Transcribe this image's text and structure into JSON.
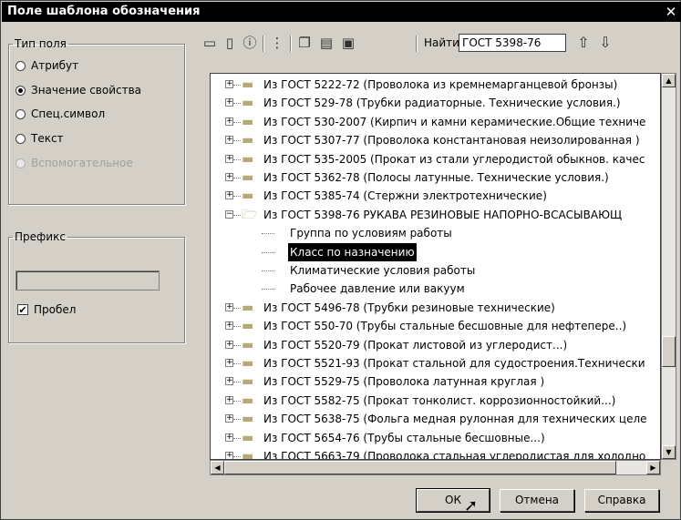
{
  "window": {
    "title": "Поле шаблона обозначения",
    "close_glyph": "✕"
  },
  "field_type": {
    "legend": "Тип поля",
    "options": [
      {
        "label": "Атрибут",
        "checked": false,
        "disabled": false
      },
      {
        "label": "Значение свойства",
        "checked": true,
        "disabled": false
      },
      {
        "label": "Спец.символ",
        "checked": false,
        "disabled": false
      },
      {
        "label": "Текст",
        "checked": false,
        "disabled": false
      },
      {
        "label": "Вспомогательное",
        "checked": false,
        "disabled": true
      }
    ]
  },
  "prefix": {
    "legend": "Префикс",
    "value": "",
    "space_checkbox": {
      "label": "Пробел",
      "checked": true,
      "mark": "✔"
    }
  },
  "toolbar": {
    "icons": [
      "folder-icon",
      "new-document-icon",
      "info-icon",
      "properties-icon",
      "copy-icon",
      "paste-icon",
      "clipboard-icon"
    ],
    "find_label": "Найти",
    "find_value": "ГОСТ 5398-76",
    "up_glyph": "⇧",
    "down_glyph": "⇩"
  },
  "tree": {
    "items": [
      {
        "level": 0,
        "text": "Из ГОСТ 5222-72 (Проволока из кремнемарганцевой бронзы)",
        "expander": "+"
      },
      {
        "level": 0,
        "text": "Из ГОСТ 529-78 (Трубки радиаторные. Технические условия.)",
        "expander": "+"
      },
      {
        "level": 0,
        "text": "Из ГОСТ 530-2007 (Кирпич и камни керамические.Общие техниче",
        "expander": "+"
      },
      {
        "level": 0,
        "text": "Из ГОСТ 5307-77 (Проволока константановая неизолированная )",
        "expander": "+"
      },
      {
        "level": 0,
        "text": "Из ГОСТ 535-2005 (Прокат из стали углеродистой обыкнов. качес",
        "expander": "+"
      },
      {
        "level": 0,
        "text": "Из ГОСТ 5362-78 (Полосы латунные. Технические условия.)",
        "expander": "+"
      },
      {
        "level": 0,
        "text": "Из ГОСТ 5385-74 (Стержни электротехнические)",
        "expander": "+"
      },
      {
        "level": 0,
        "text": "Из ГОСТ 5398-76 РУКАВА РЕЗИНОВЫЕ НАПОРНО-ВСАСЫВАЮЩ",
        "expander": "−",
        "open": true
      },
      {
        "level": 1,
        "text": "Группа по условиям работы"
      },
      {
        "level": 1,
        "text": "Класс по назначению",
        "selected": true
      },
      {
        "level": 1,
        "text": "Климатические условия работы"
      },
      {
        "level": 1,
        "text": "Рабочее давление или вакуум"
      },
      {
        "level": 0,
        "text": "Из ГОСТ 5496-78 (Трубки резиновые технические)",
        "expander": "+"
      },
      {
        "level": 0,
        "text": "Из ГОСТ 550-70 (Трубы стальные бесшовные для нефтепере..)",
        "expander": "+"
      },
      {
        "level": 0,
        "text": "Из ГОСТ 5520-79 (Прокат листовой из углеродист...)",
        "expander": "+"
      },
      {
        "level": 0,
        "text": "Из ГОСТ 5521-93 (Прокат стальной для судостроения.Технически",
        "expander": "+"
      },
      {
        "level": 0,
        "text": "Из ГОСТ 5529-75 (Проволока латунная круглая )",
        "expander": "+"
      },
      {
        "level": 0,
        "text": "Из ГОСТ 5582-75 (Прокат тонколист. коррозионностойкий...)",
        "expander": "+"
      },
      {
        "level": 0,
        "text": "Из ГОСТ 5638-75 (Фольга медная рулонная для технических целе",
        "expander": "+"
      },
      {
        "level": 0,
        "text": "Из ГОСТ 5654-76 (Трубы стальные бесшовные...)",
        "expander": "+"
      },
      {
        "level": 0,
        "text": "Из ГОСТ 5663-79 (Проволока стальная углеродистая для холодно",
        "expander": "+"
      }
    ]
  },
  "scroll": {
    "up": "▲",
    "down": "▼",
    "left": "◀",
    "right": "▶"
  },
  "buttons": {
    "ok": "ОК",
    "cancel": "Отмена",
    "help": "Справка"
  }
}
